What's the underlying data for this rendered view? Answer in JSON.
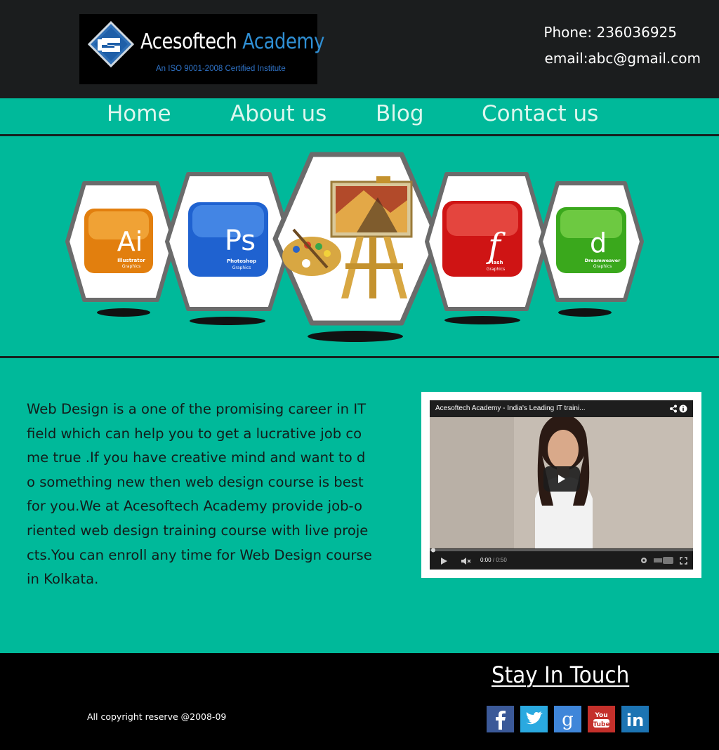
{
  "colors": {
    "accent": "#00b99a",
    "header_bg": "#1b1d1e",
    "nav_text": "#ddf6ee",
    "brand_blue": "#2f8fd4"
  },
  "header": {
    "logo": {
      "name_part1": "Acesoftech",
      "name_part2": "Academy",
      "tagline": "An ISO 9001-2008 Certified Institute"
    },
    "phone": "Phone: 236036925",
    "email": "email:abc@gmail.com"
  },
  "nav": {
    "items": [
      {
        "label": "Home"
      },
      {
        "label": "About us"
      },
      {
        "label": "Blog"
      },
      {
        "label": "Contact us"
      }
    ]
  },
  "hero": {
    "courses": [
      {
        "icon": "illustrator-icon",
        "letters": "Ai",
        "name": "Illustrator",
        "sub": "Graphics"
      },
      {
        "icon": "photoshop-icon",
        "letters": "Ps",
        "name": "Photoshop",
        "sub": "Graphics"
      },
      {
        "icon": "easel-palette-icon"
      },
      {
        "icon": "flash-icon",
        "letters": "f",
        "name": "Flash",
        "sub": "Graphics"
      },
      {
        "icon": "dreamweaver-icon",
        "letters": "d",
        "name": "Dreamweaver",
        "sub": "Graphics"
      }
    ]
  },
  "intro": {
    "lines": [
      "Web Design is a one of the promising career in IT",
      " field which can help you to get a lucrative job co",
      "me true .If you have creative mind and want to d",
      "o something new then web design course is best",
      " for you.We at Acesoftech Academy provide job-o",
      "riented web design training course with live proje",
      "cts.You can enroll any time for Web Design course",
      " in Kolkata."
    ]
  },
  "video": {
    "title": "Acesoftech Academy - India's Leading IT traini...",
    "time_current": "0:00",
    "time_total": "/ 0:50",
    "progress": 0
  },
  "footer": {
    "copyright": "All copyright reserve @2008-09",
    "stay_in_touch": "Stay In Touch",
    "social": [
      {
        "icon": "facebook-icon",
        "glyph": "f",
        "color": "#3b5998"
      },
      {
        "icon": "twitter-icon",
        "glyph": "t",
        "color": "#2aa9e0"
      },
      {
        "icon": "google-plus-icon",
        "glyph": "g",
        "color": "#3f86d9"
      },
      {
        "icon": "youtube-icon",
        "glyph": "You Tube",
        "color": "#c4302b"
      },
      {
        "icon": "linkedin-icon",
        "glyph": "in",
        "color": "#1c74b3"
      }
    ]
  }
}
